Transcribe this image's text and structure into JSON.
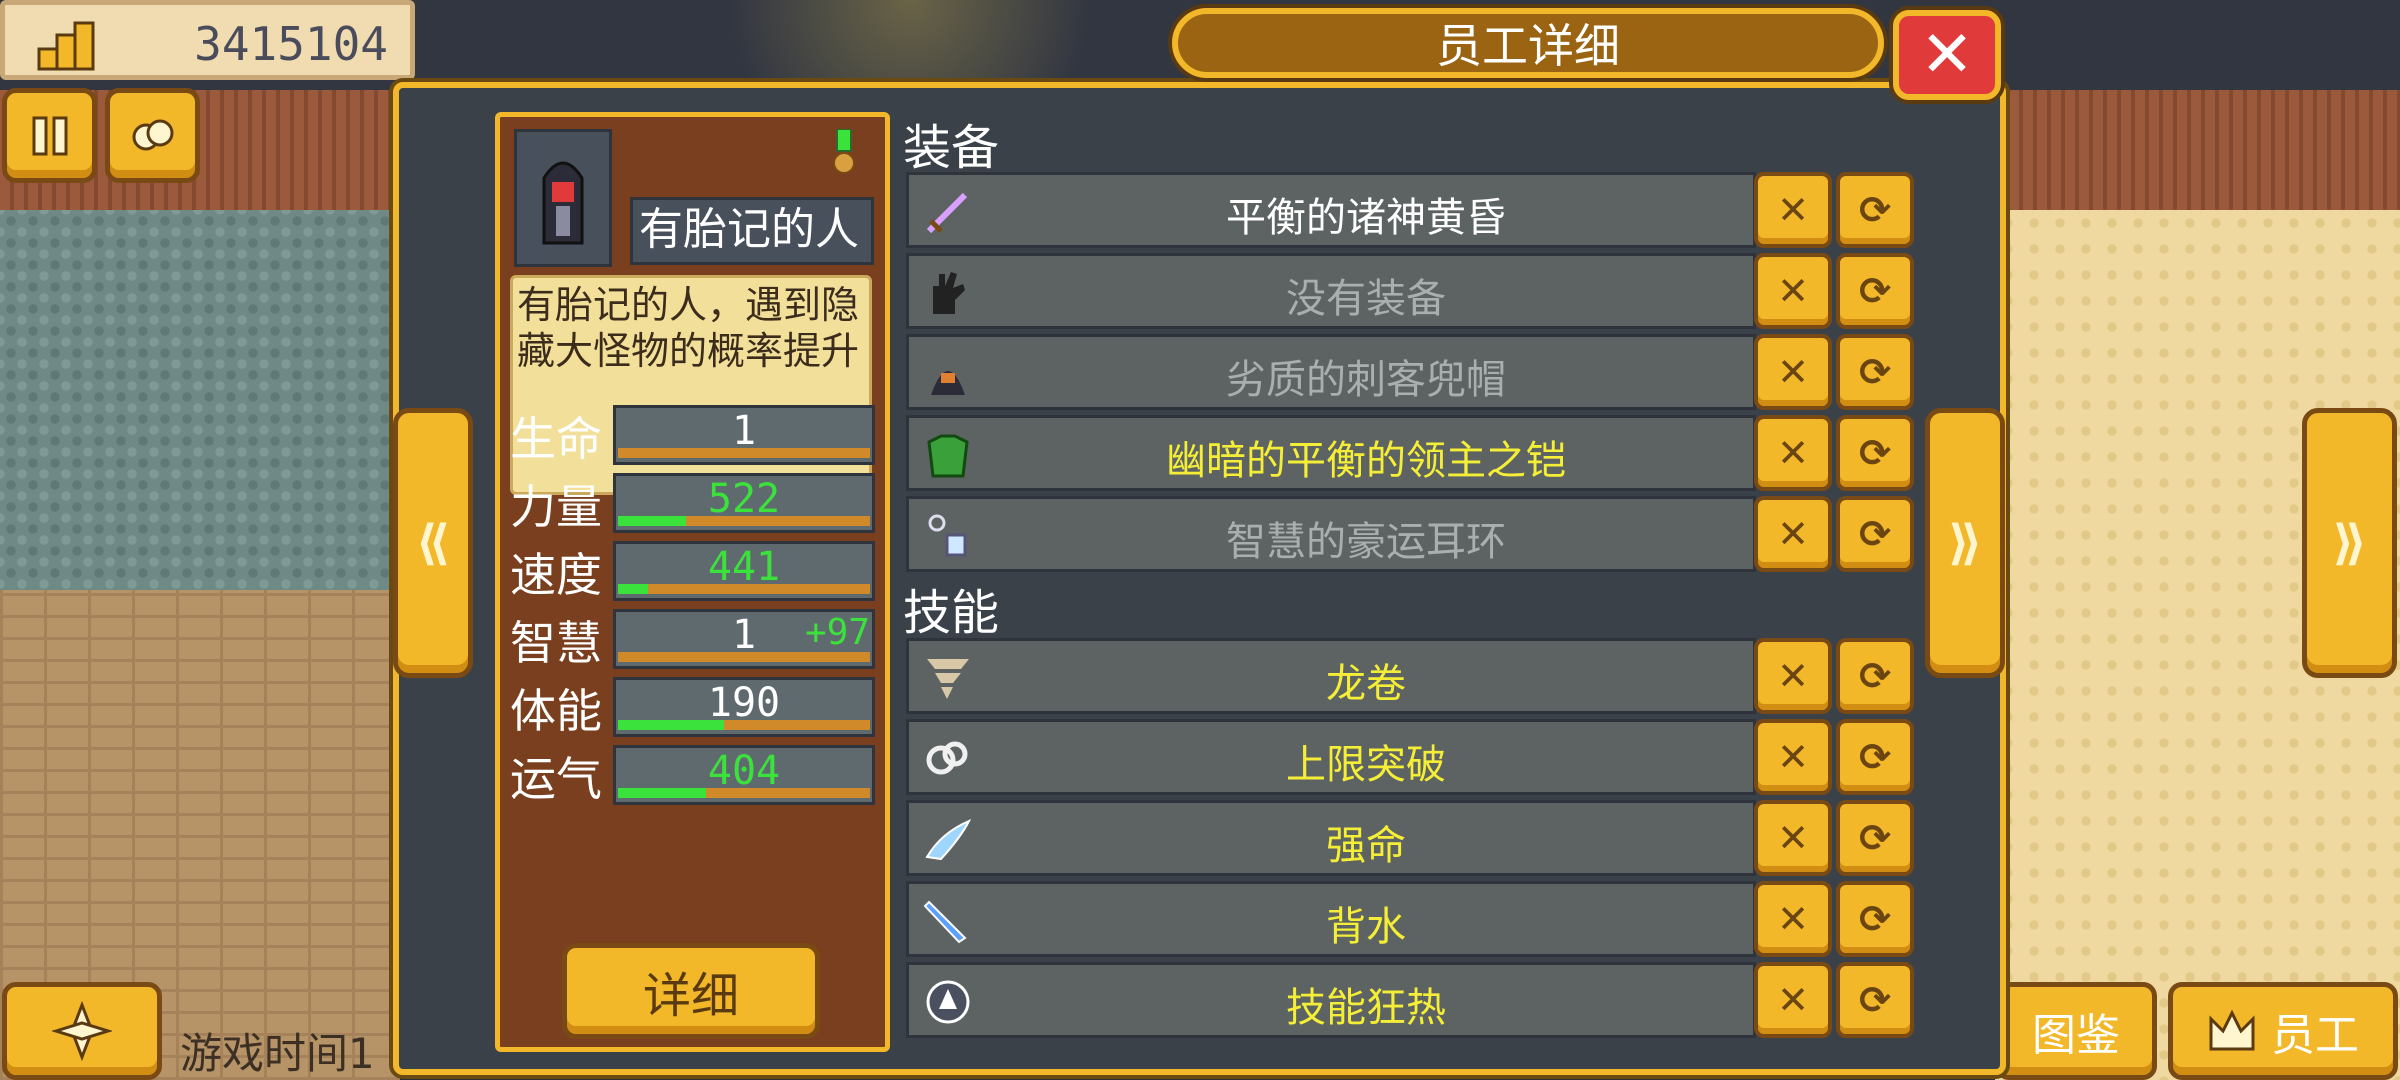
{
  "money": {
    "value": "3415104",
    "icon": "coins-stack-icon"
  },
  "hud": {
    "pause_icon": "pause-icon",
    "swap_icon": "swap-icon",
    "compass_icon": "compass-icon",
    "game_time_label": "游戏时间1",
    "tabs": [
      {
        "label": "图鉴",
        "icon": ""
      },
      {
        "label": "员工",
        "icon": "crown-icon"
      }
    ]
  },
  "dialog": {
    "title": "员工详细",
    "close_glyph": "✕",
    "prev_glyph": "⟪",
    "next_glyph": "⟫"
  },
  "character": {
    "name": "有胎记的人",
    "description": "有胎记的人，遇到隐藏大怪物的概率提升",
    "detail_button": "详细",
    "stats": [
      {
        "label": "生命",
        "value": "1",
        "bonus": "",
        "color": "white",
        "fill": 0.0
      },
      {
        "label": "力量",
        "value": "522",
        "bonus": "",
        "color": "green",
        "fill": 0.27
      },
      {
        "label": "速度",
        "value": "441",
        "bonus": "",
        "color": "green",
        "fill": 0.12
      },
      {
        "label": "智慧",
        "value": "1",
        "bonus": "+97",
        "color": "white",
        "fill": 0.0
      },
      {
        "label": "体能",
        "value": "190",
        "bonus": "",
        "color": "white",
        "fill": 0.42
      },
      {
        "label": "运气",
        "value": "404",
        "bonus": "",
        "color": "green",
        "fill": 0.35
      }
    ]
  },
  "equipment": {
    "title": "装备",
    "items": [
      {
        "name": "平衡的诸神黄昏",
        "color": "white",
        "icon": "sword-icon"
      },
      {
        "name": "没有装备",
        "color": "gray",
        "icon": "glove-icon"
      },
      {
        "name": "劣质的刺客兜帽",
        "color": "gray",
        "icon": "hood-icon"
      },
      {
        "name": "幽暗的平衡的领主之铠",
        "color": "yellow",
        "icon": "armor-icon"
      },
      {
        "name": "智慧的豪运耳环",
        "color": "gray",
        "icon": "earring-icon"
      }
    ]
  },
  "skills": {
    "title": "技能",
    "items": [
      {
        "name": "龙卷",
        "color": "yellow",
        "icon": "tornado-icon"
      },
      {
        "name": "上限突破",
        "color": "yellow",
        "icon": "chain-icon"
      },
      {
        "name": "强命",
        "color": "yellow",
        "icon": "wing-icon"
      },
      {
        "name": "背水",
        "color": "yellow",
        "icon": "blade-icon"
      },
      {
        "name": "技能狂热",
        "color": "yellow",
        "icon": "orb-icon"
      }
    ]
  },
  "row_buttons": {
    "remove_glyph": "✕",
    "replace_glyph": "⟳"
  },
  "colors": {
    "gold": "#f2b829",
    "panel_brown": "#7a3f1e",
    "close_red": "#e03a3a",
    "stat_green": "#3ce23c",
    "item_yellow": "#f5ee36",
    "item_gray": "#a9aeae"
  }
}
